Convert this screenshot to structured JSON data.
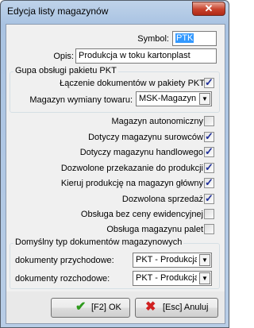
{
  "window": {
    "title": "Edycja listy magazynów",
    "close_label": "✕"
  },
  "symbol": {
    "label": "Symbol:",
    "value": "PTK"
  },
  "opis": {
    "label": "Opis:",
    "value": "Produkcja w toku kartonplast"
  },
  "pkt_group": {
    "label": "Gupa obsługi pakietu PKT",
    "laczenie": {
      "label": "Łączenie dokumentów w pakiety PKT",
      "checked": true
    },
    "magazyn_wymiany": {
      "label": "Magazyn wymiany towaru:",
      "value": "MSK-Magazyn"
    }
  },
  "options": [
    {
      "label": "Magazyn autonomiczny",
      "checked": false
    },
    {
      "label": "Dotyczy magazynu surowców",
      "checked": true
    },
    {
      "label": "Dotyczy magazynu handlowego",
      "checked": true
    },
    {
      "label": "Dozwolone przekazanie do produkcji",
      "checked": true
    },
    {
      "label": "Kieruj produkcję na magazyn główny",
      "checked": true
    },
    {
      "label": "Dozwolona sprzedaż",
      "checked": true
    },
    {
      "label": "Obsługa bez ceny ewidencyjnej",
      "checked": false
    },
    {
      "label": "Obsługa magazynu palet",
      "checked": false
    }
  ],
  "doc_group": {
    "label": "Domyślny typ dokumentów magazynowych",
    "przychodowe": {
      "label": "dokumenty przychodowe:",
      "value": "PKT - Produkcja w"
    },
    "rozchodowe": {
      "label": "dokumenty rozchodowe:",
      "value": "PKT - Produkcja w"
    }
  },
  "buttons": {
    "ok": {
      "label": "[F2] OK",
      "icon": "check-icon"
    },
    "cancel": {
      "label": "[Esc] Anuluj",
      "icon": "x-icon"
    }
  },
  "colors": {
    "check": "#21319a",
    "selection": "#3399ff",
    "ok_icon": "#2e9a1d",
    "cancel_icon": "#d02020"
  }
}
